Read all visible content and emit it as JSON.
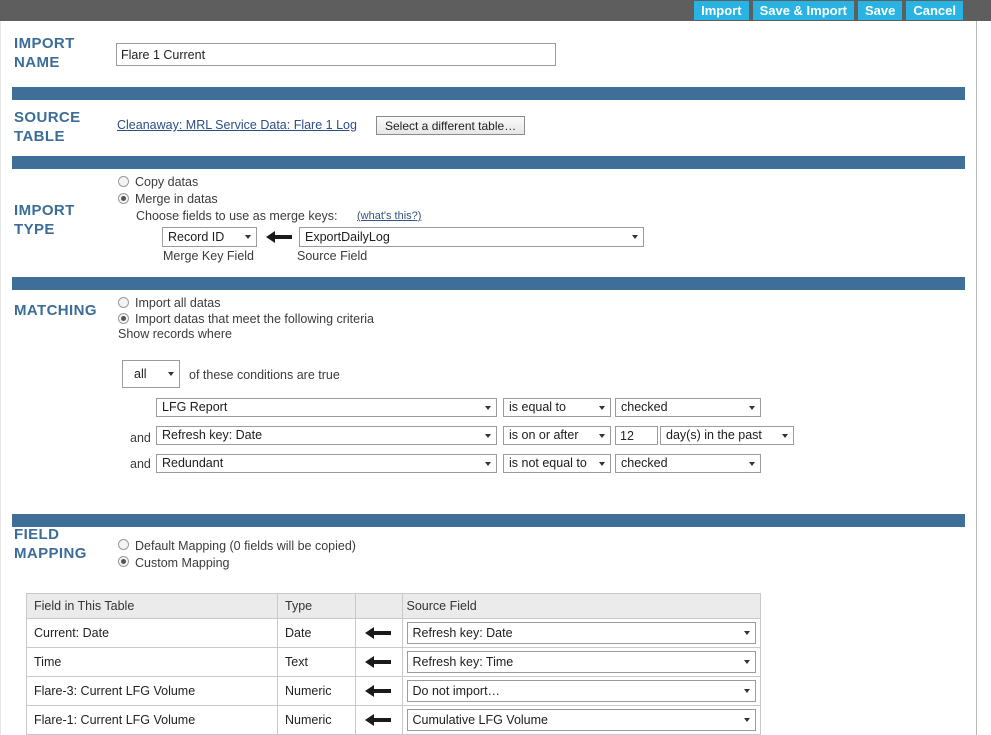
{
  "topbar": {
    "buttons": [
      {
        "label": "Import",
        "name": "import-button"
      },
      {
        "label": "Save & Import",
        "name": "save-and-import-button"
      },
      {
        "label": "Save",
        "name": "save-button"
      },
      {
        "label": "Cancel",
        "name": "cancel-button"
      }
    ],
    "accent_color": "#29b3e3",
    "bar_color": "#5e5e5e"
  },
  "theme": {
    "section_heading_color": "#3c6d99",
    "divider_color": "#3f6f99"
  },
  "import_name": {
    "heading_line1": "IMPORT",
    "heading_line2": "NAME",
    "value": "Flare 1 Current",
    "placeholder": "Import name"
  },
  "source_table": {
    "heading_line1": "SOURCE",
    "heading_line2": "TABLE",
    "table_link": "Cleanaway: MRL Service Data: Flare 1 Log",
    "select_button": "Select a different table…"
  },
  "import_type": {
    "heading_line1": "IMPORT",
    "heading_line2": "TYPE",
    "option_copy": "Copy datas",
    "option_merge": "Merge in datas",
    "copy_selected": false,
    "merge_selected": true,
    "merge_keys_prompt": "Choose fields to use as merge keys:",
    "whats_this": "(what's this?)",
    "merge_key_field_value": "Record ID",
    "source_field_value": "ExportDailyLog",
    "merge_key_caption": "Merge Key Field",
    "source_field_caption": "Source Field"
  },
  "matching": {
    "heading": "MATCHING",
    "option_all": "Import all datas",
    "option_criteria": "Import datas that meet the following criteria",
    "all_selected": false,
    "criteria_selected": true,
    "show_records_where": "Show records where",
    "conjunction_value": "all",
    "conditions_suffix": "of these conditions are true",
    "and_label": "and",
    "conditions": [
      {
        "prefix": "",
        "field": "LFG Report",
        "operator": "is equal to",
        "value": "checked",
        "extra_value": null,
        "extra_unit": null
      },
      {
        "prefix": "and",
        "field": "Refresh key: Date",
        "operator": "is on or after",
        "value": null,
        "extra_value": "12",
        "extra_unit": "day(s) in the past"
      },
      {
        "prefix": "and",
        "field": "Redundant",
        "operator": "is not equal to",
        "value": "checked",
        "extra_value": null,
        "extra_unit": null
      }
    ]
  },
  "field_mapping": {
    "heading_line1": "FIELD",
    "heading_line2": "MAPPING",
    "option_default": "Default Mapping (0 fields will be copied)",
    "option_custom": "Custom Mapping",
    "default_selected": false,
    "custom_selected": true,
    "columns": [
      "Field in This Table",
      "Type",
      "",
      "Source Field"
    ],
    "rows": [
      {
        "field": "Current: Date",
        "type": "Date",
        "arrow": "arrow-left-icon",
        "source": "Refresh key: Date"
      },
      {
        "field": "Time",
        "type": "Text",
        "arrow": "arrow-left-icon",
        "source": "Refresh key: Time"
      },
      {
        "field": "Flare-3: Current LFG Volume",
        "type": "Numeric",
        "arrow": "arrow-left-icon",
        "source": "Do not import…"
      },
      {
        "field": "Flare-1: Current LFG Volume",
        "type": "Numeric",
        "arrow": "arrow-left-icon",
        "source": "Cumulative LFG Volume"
      }
    ]
  }
}
